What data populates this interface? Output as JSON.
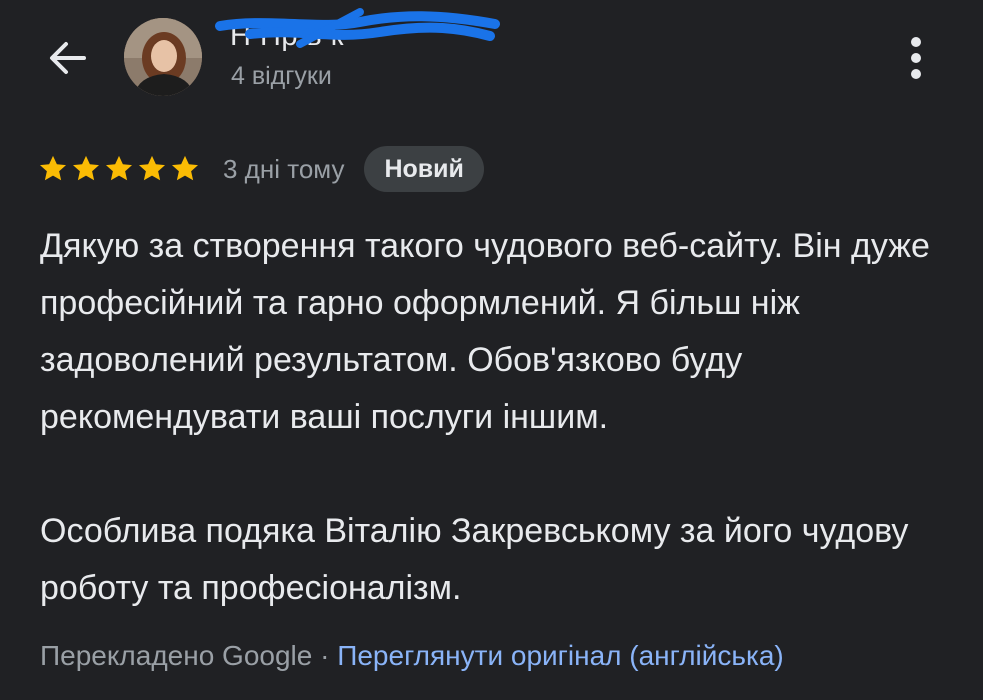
{
  "header": {
    "author_name": "Н Пр ь к",
    "review_count": "4 відгуки",
    "back_icon": "arrow-back-icon",
    "more_icon": "more-vert-icon"
  },
  "review": {
    "rating": 5,
    "rating_max": 5,
    "star_color": "#fbbc04",
    "time_ago": "3 дні тому",
    "badge": "Новий",
    "paragraphs": [
      "Дякую за створення такого чудового веб-сайту. Він дуже професійний та гарно оформлений. Я більш ніж задоволений результатом. Обов'язково буду рекомендувати ваші послуги іншим.",
      "Особлива подяка Віталію Закревському за його чудову роботу та професіоналізм."
    ]
  },
  "translation": {
    "label": "Перекладено Google",
    "separator": " · ",
    "link": "Переглянути оригінал (англійська)"
  },
  "colors": {
    "background": "#202124",
    "text": "#e8eaed",
    "secondary": "#9aa0a6",
    "link": "#8ab4f8",
    "badge_bg": "#3c4043",
    "scribble": "#1a73e8"
  }
}
